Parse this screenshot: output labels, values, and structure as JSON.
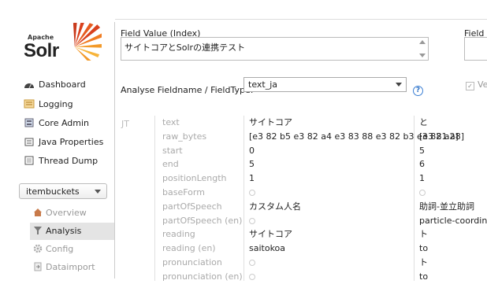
{
  "logo": {
    "apache": "Apache",
    "solr": "Solr"
  },
  "sidebar": {
    "items": [
      {
        "label": "Dashboard",
        "icon": "dashboard-icon"
      },
      {
        "label": "Logging",
        "icon": "logging-icon"
      },
      {
        "label": "Core Admin",
        "icon": "core-admin-icon"
      },
      {
        "label": "Java Properties",
        "icon": "java-properties-icon"
      },
      {
        "label": "Thread Dump",
        "icon": "thread-dump-icon"
      }
    ],
    "core_selector": {
      "value": "itembuckets"
    },
    "core_items": [
      {
        "label": "Overview",
        "icon": "house-icon",
        "active": false
      },
      {
        "label": "Analysis",
        "icon": "funnel-icon",
        "active": true
      },
      {
        "label": "Config",
        "icon": "gear-icon",
        "active": false
      },
      {
        "label": "Dataimport",
        "icon": "import-icon",
        "active": false
      }
    ]
  },
  "main": {
    "field_value_index_label": "Field Value (Index)",
    "field_value_index": "サイトコアとSolrの連携テスト",
    "field_value_query_label": "Field V",
    "fieldtype_label": "Analyse Fieldname / FieldType:",
    "fieldtype_value": "text_ja",
    "help_symbol": "?",
    "verbose_label": "Ve"
  },
  "analysis": {
    "tokenizer_short": "JT",
    "rows": [
      {
        "key": "text",
        "v1": "サイトコア",
        "v2": "と"
      },
      {
        "key": "raw_bytes",
        "v1": "[e3 82 b5 e3 82 a4 e3 83 88 e3 82 b3 e3 82 a2]",
        "v2": "[e3 81 a8]"
      },
      {
        "key": "start",
        "v1": "0",
        "v2": "5"
      },
      {
        "key": "end",
        "v1": "5",
        "v2": "6"
      },
      {
        "key": "positionLength",
        "v1": "1",
        "v2": "1"
      },
      {
        "key": "baseForm",
        "v1": "",
        "v2": ""
      },
      {
        "key": "partOfSpeech",
        "v1": "カスタム人名",
        "v2": "助詞-並立助詞"
      },
      {
        "key": "partOfSpeech (en)",
        "v1": "",
        "v2": "particle-coordinate"
      },
      {
        "key": "reading",
        "v1": "サイトコア",
        "v2": "ト"
      },
      {
        "key": "reading (en)",
        "v1": "saitokoa",
        "v2": "to"
      },
      {
        "key": "pronunciation",
        "v1": "",
        "v2": "ト"
      },
      {
        "key": "pronunciation (en)",
        "v1": "",
        "v2": "to"
      }
    ]
  }
}
